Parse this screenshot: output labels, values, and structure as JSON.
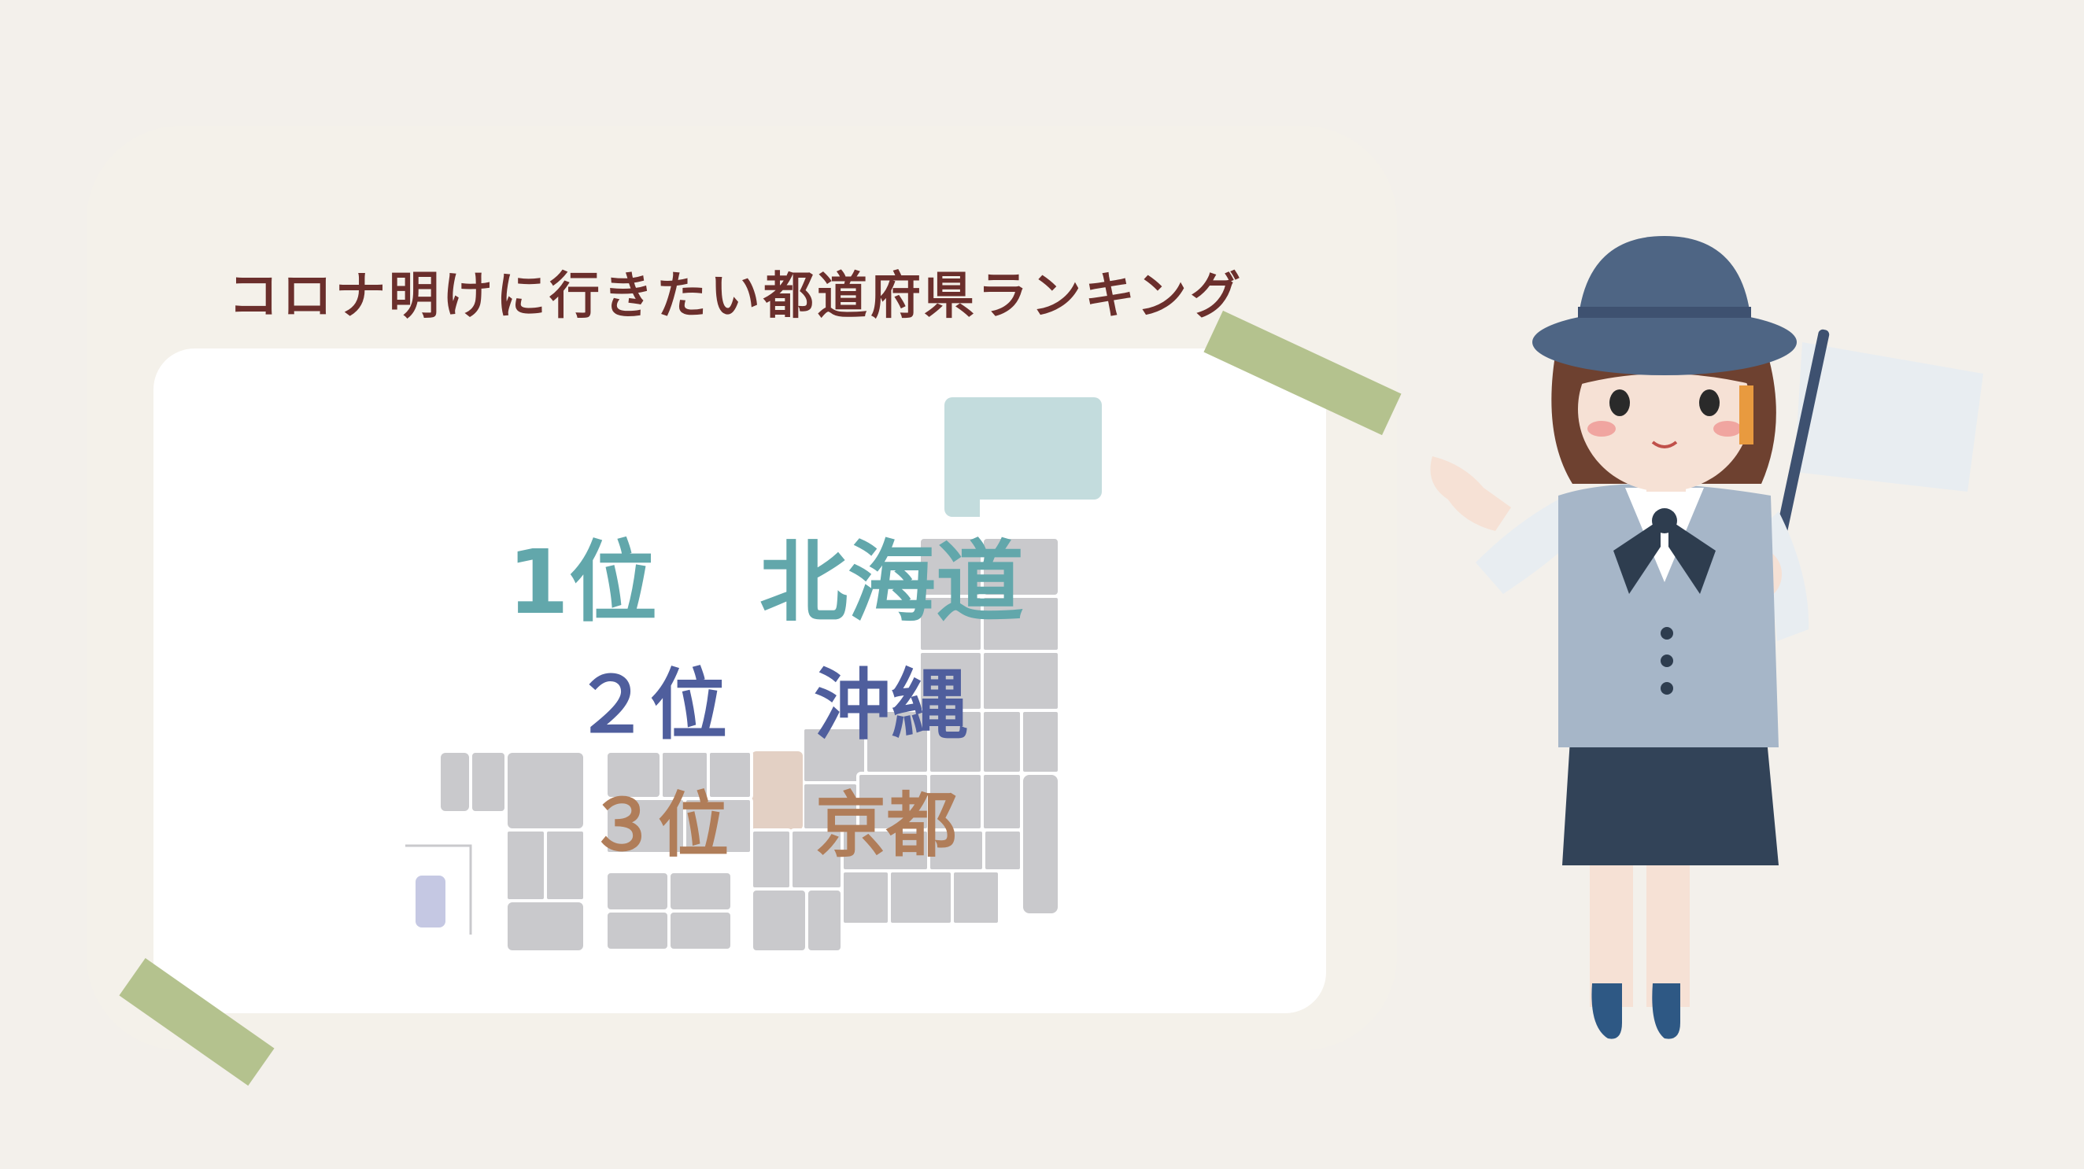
{
  "title": "コロナ明けに行きたい都道府県ランキング",
  "ranking": [
    {
      "rank": "1位",
      "name": "北海道",
      "color": "#62a7ab"
    },
    {
      "rank": "２位",
      "name": "沖縄",
      "color": "#4f5e9d"
    },
    {
      "rank": "３位",
      "name": "京都",
      "color": "#b07d59"
    }
  ],
  "colors": {
    "background": "#f3f0eb",
    "card": "#ffffff",
    "title": "#6b2f2c",
    "tape": "#b4c28e",
    "map_gray": "#c9c9cc",
    "hokkaido": "#c3dcdd",
    "okinawa": "#c5c8e3",
    "kyoto": "#e3d0c4"
  },
  "icons": {
    "guide": "tour-guide-illustration",
    "flag": "flag-icon",
    "map": "japan-map-illustration"
  }
}
